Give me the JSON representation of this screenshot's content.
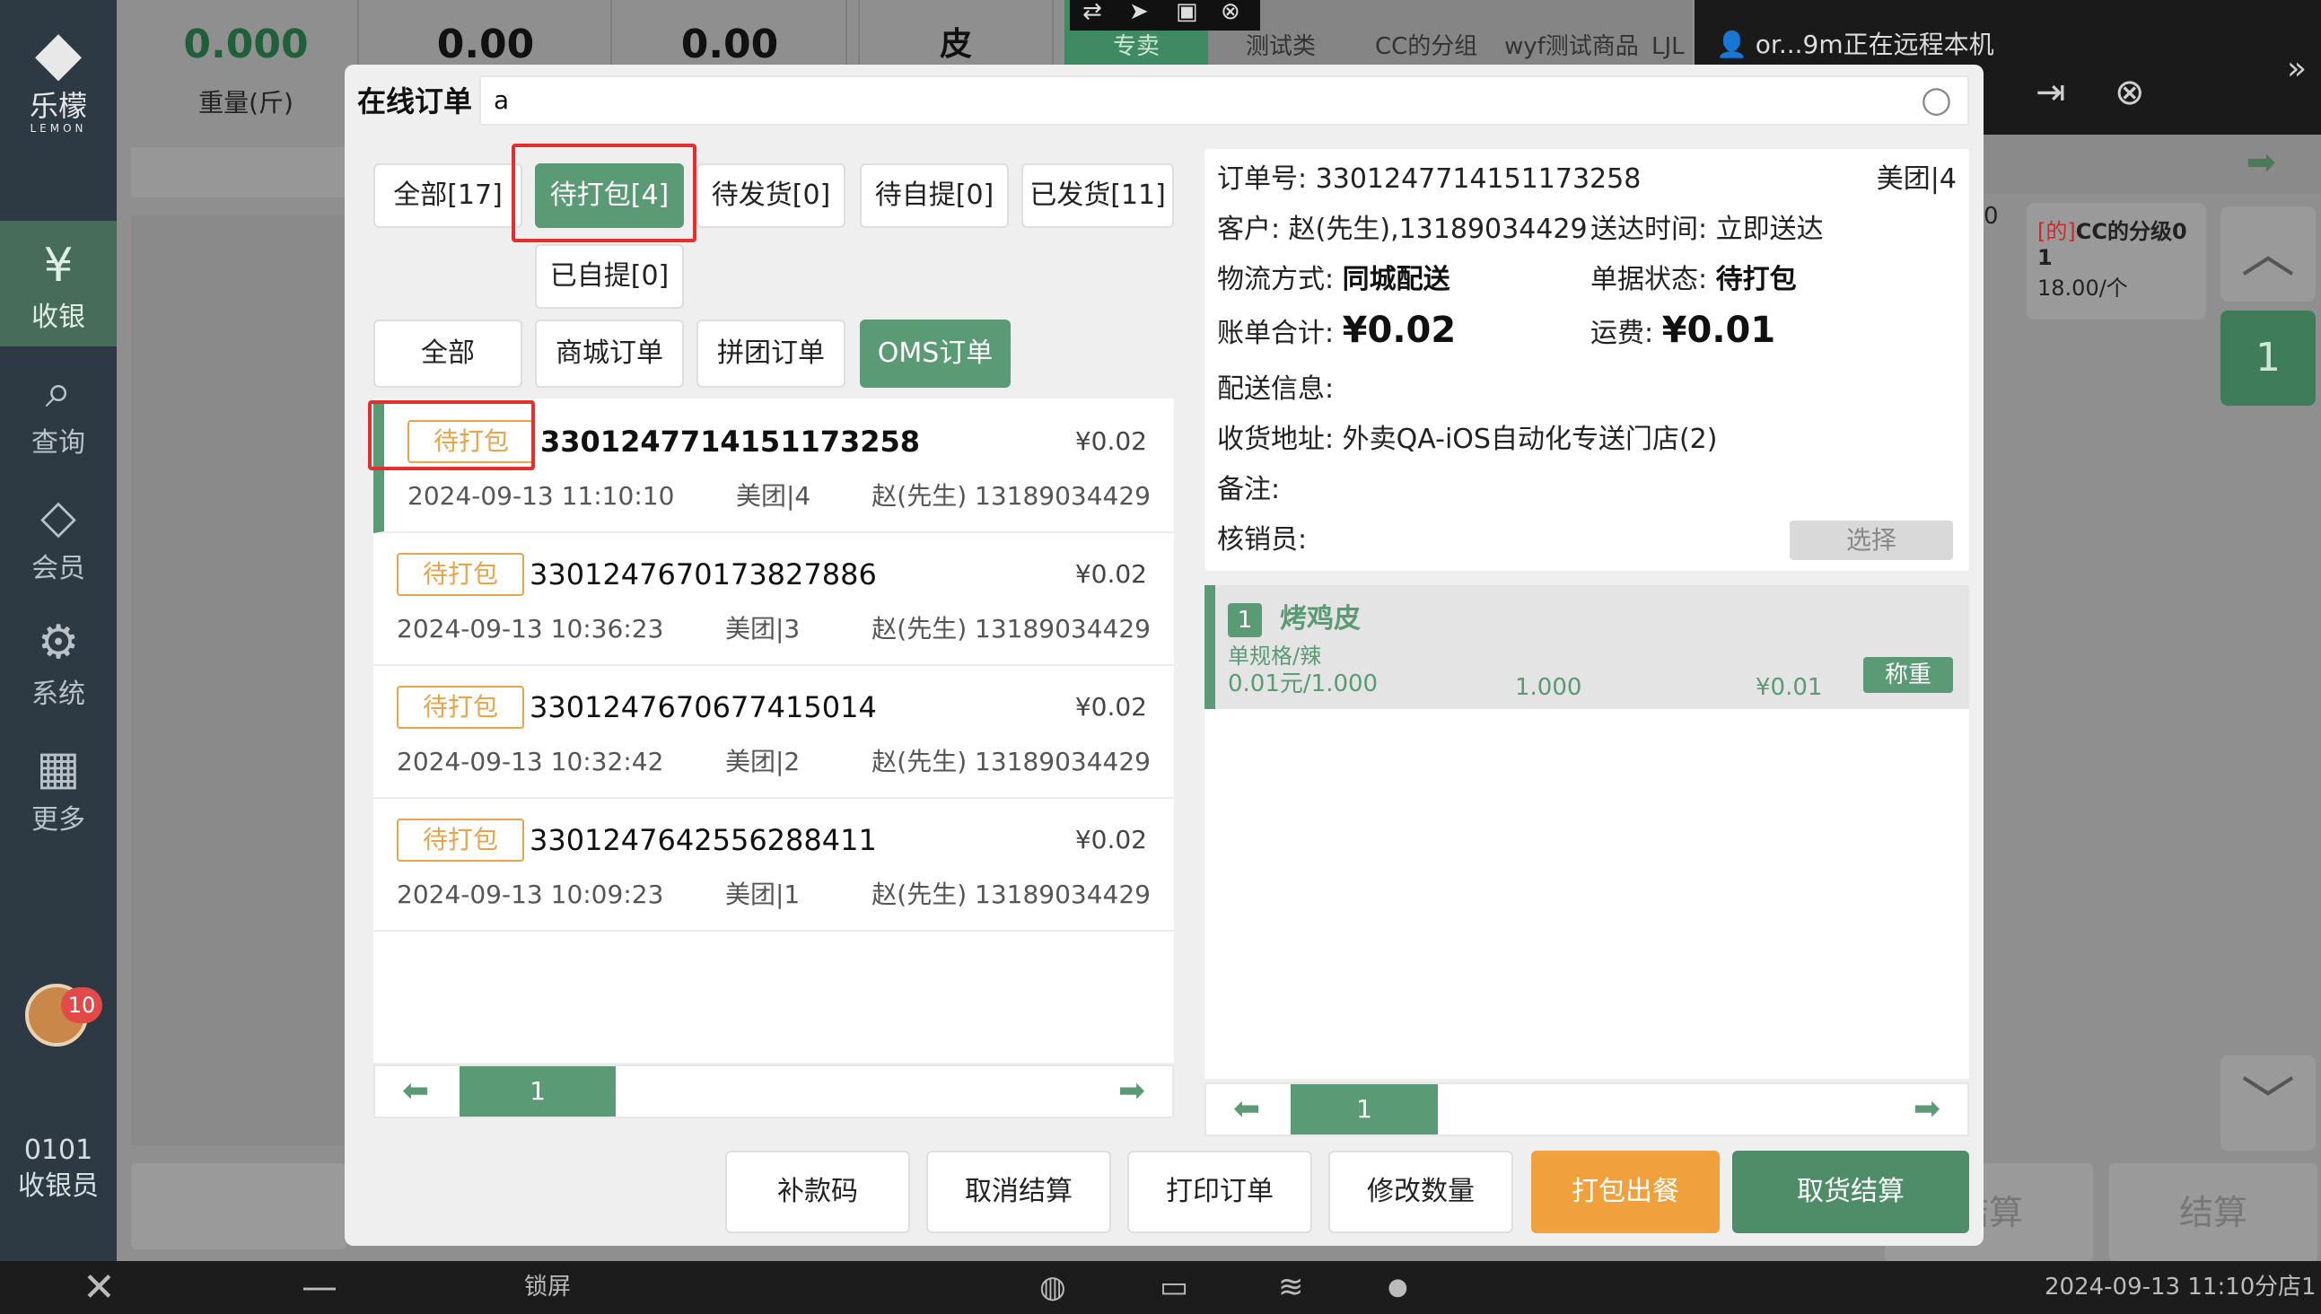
{
  "sidebar": {
    "logo_name": "乐檬",
    "logo_sub": "LEMON",
    "items": [
      {
        "label": "收银",
        "icon": "cashier-icon",
        "glyph": "¥"
      },
      {
        "label": "查询",
        "icon": "search-doc-icon",
        "glyph": "⌕"
      },
      {
        "label": "会员",
        "icon": "member-diamond-icon",
        "glyph": "◇"
      },
      {
        "label": "系统",
        "icon": "gear-icon",
        "glyph": "⚙"
      },
      {
        "label": "更多",
        "icon": "grid-icon",
        "glyph": "▦"
      }
    ],
    "badge_count": "10",
    "cashier_id": "0101",
    "cashier_role": "收银员"
  },
  "background": {
    "weight_value": "0.000",
    "weight_label": "重量(斤)",
    "v2": "0.00",
    "v3": "0.00",
    "v4": "皮",
    "tabs": [
      "专卖",
      "测试类",
      "CC的分组",
      "wyf测试商品",
      "LJL"
    ],
    "remote_text": "or...9m正在远程本机",
    "card_tag": "[的]",
    "card_title": "CC的分级0",
    "card_qty": "1",
    "card_price": "18.00/个",
    "card_left": "0",
    "qty": "1",
    "settle1": "结算",
    "settle2": "结算"
  },
  "modal": {
    "title": "在线订单",
    "search_value": "a",
    "status_tabs": [
      "全部[17]",
      "待打包[4]",
      "待发货[0]",
      "待自提[0]",
      "已发货[11]",
      "已自提[0]"
    ],
    "type_tabs": [
      "全部",
      "商城订单",
      "拼团订单",
      "OMS订单"
    ],
    "orders": [
      {
        "tag": "待打包",
        "no": "3301247714151173258",
        "amount": "¥0.02",
        "time": "2024-09-13 11:10:10",
        "platform": "美团|4",
        "customer": "赵(先生) 13189034429"
      },
      {
        "tag": "待打包",
        "no": "3301247670173827886",
        "amount": "¥0.02",
        "time": "2024-09-13 10:36:23",
        "platform": "美团|3",
        "customer": "赵(先生) 13189034429"
      },
      {
        "tag": "待打包",
        "no": "3301247670677415014",
        "amount": "¥0.02",
        "time": "2024-09-13 10:32:42",
        "platform": "美团|2",
        "customer": "赵(先生) 13189034429"
      },
      {
        "tag": "待打包",
        "no": "3301247642556288411",
        "amount": "¥0.02",
        "time": "2024-09-13 10:09:23",
        "platform": "美团|1",
        "customer": "赵(先生) 13189034429"
      }
    ],
    "list_page": "1",
    "detail": {
      "order_no_label": "订单号:",
      "order_no": "3301247714151173258",
      "platform": "美团|4",
      "customer_label": "客户:",
      "customer": "赵(先生),13189034429",
      "delivery_time_label": "送达时间:",
      "delivery_time": "立即送达",
      "logistics_label": "物流方式:",
      "logistics": "同城配送",
      "status_label": "单据状态:",
      "status": "待打包",
      "total_label": "账单合计:",
      "total": "¥0.02",
      "freight_label": "运费:",
      "freight": "¥0.01",
      "delivery_info_label": "配送信息:",
      "address_label": "收货地址:",
      "address": "外卖QA-iOS自动化专送门店(2)",
      "remark_label": "备注:",
      "verifier_label": "核销员:",
      "select_btn": "选择"
    },
    "item": {
      "index": "1",
      "name": "烤鸡皮",
      "spec": "单规格/辣",
      "unit_price": "0.01元/1.000",
      "qty": "1.000",
      "amount": "¥0.01",
      "weigh_btn": "称重"
    },
    "item_page": "1",
    "actions": [
      "补款码",
      "取消结算",
      "打印订单",
      "修改数量",
      "打包出餐",
      "取货结算"
    ]
  },
  "bottombar": {
    "lock": "锁屏",
    "datetime": "2024-09-13 11:10",
    "store": "分店1"
  }
}
